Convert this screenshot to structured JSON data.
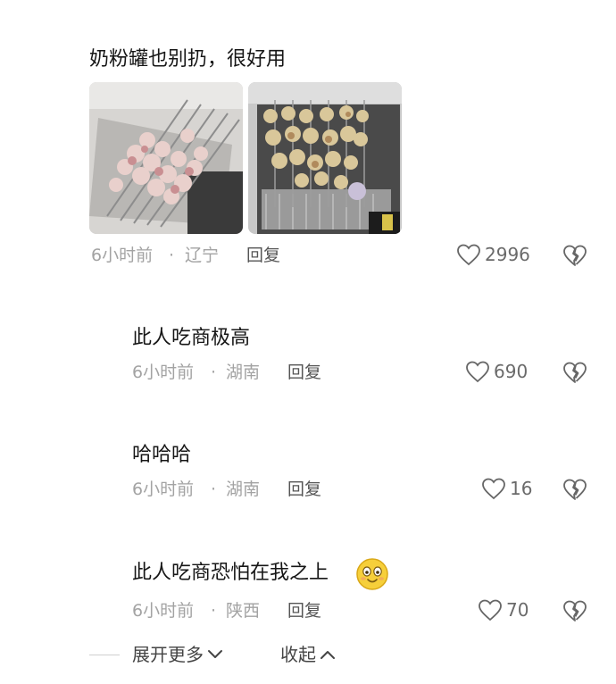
{
  "comments": [
    {
      "text": "奶粉罐也别扔，很好用",
      "time": "6小时前",
      "dot": "·",
      "location": "辽宁",
      "reply": "回复",
      "likes": "2996",
      "images": [
        "photo-1",
        "photo-2"
      ]
    },
    {
      "text": "此人吃商极高",
      "time": "6小时前",
      "dot": "·",
      "location": "湖南",
      "reply": "回复",
      "likes": "690"
    },
    {
      "text": "哈哈哈",
      "time": "6小时前",
      "dot": "·",
      "location": "湖南",
      "reply": "回复",
      "likes": "16"
    },
    {
      "text": "此人吃商恐怕在我之上",
      "time": "6小时前",
      "dot": "·",
      "location": "陕西",
      "reply": "回复",
      "likes": "70"
    }
  ],
  "footer": {
    "expand": "展开更多",
    "collapse": "收起"
  },
  "icons": {
    "like": "heart-outline-icon",
    "dislike": "broken-heart-icon",
    "emoji": "smiling-face-emoji"
  }
}
